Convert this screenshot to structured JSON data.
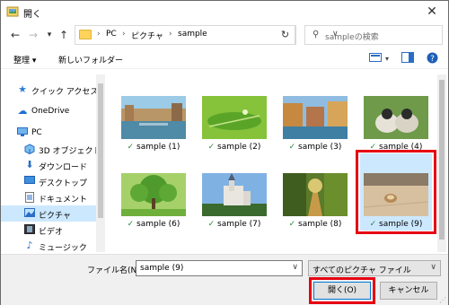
{
  "window": {
    "title": "開く",
    "close_glyph": "✕"
  },
  "nav": {
    "breadcrumb": [
      "PC",
      "ピクチャ",
      "sample"
    ],
    "separator": "›",
    "search_placeholder": "sampleの検索"
  },
  "toolbar": {
    "organize_label": "整理 ▾",
    "new_folder_label": "新しいフォルダー"
  },
  "sidebar": {
    "items": [
      {
        "label": "クイック アクセス",
        "icon": "star-icon",
        "selected": false
      },
      {
        "label": "OneDrive",
        "icon": "cloud-icon",
        "selected": false
      },
      {
        "label": "PC",
        "icon": "computer-icon",
        "selected": false
      },
      {
        "label": "3D オブジェクト",
        "icon": "cube-icon",
        "selected": false
      },
      {
        "label": "ダウンロード",
        "icon": "download-icon",
        "selected": false
      },
      {
        "label": "デスクトップ",
        "icon": "desktop-icon",
        "selected": false
      },
      {
        "label": "ドキュメント",
        "icon": "document-icon",
        "selected": false
      },
      {
        "label": "ピクチャ",
        "icon": "picture-icon",
        "selected": true
      },
      {
        "label": "ビデオ",
        "icon": "video-icon",
        "selected": false
      },
      {
        "label": "ミュージック",
        "icon": "music-icon",
        "selected": false
      }
    ]
  },
  "files": [
    {
      "name": "sample (1)",
      "scene": "canal-city"
    },
    {
      "name": "sample (2)",
      "scene": "green-leaf"
    },
    {
      "name": "sample (3)",
      "scene": "river-town"
    },
    {
      "name": "sample (4)",
      "scene": "ducklings"
    },
    {
      "name": "sample (6)",
      "scene": "tree"
    },
    {
      "name": "sample (7)",
      "scene": "castle"
    },
    {
      "name": "sample (8)",
      "scene": "forest-path"
    },
    {
      "name": "sample (9)",
      "scene": "sand-shell",
      "selected": true
    }
  ],
  "footer": {
    "filename_label": "ファイル名(N):",
    "filename_value": "sample (9)",
    "filetype_value": "すべてのピクチャ ファイル",
    "open_label": "開く(O)",
    "cancel_label": "キャンセル"
  },
  "colors": {
    "highlight_red": "#e60012",
    "selection_blue": "#cce8ff",
    "check_green": "#2e8b3d"
  }
}
